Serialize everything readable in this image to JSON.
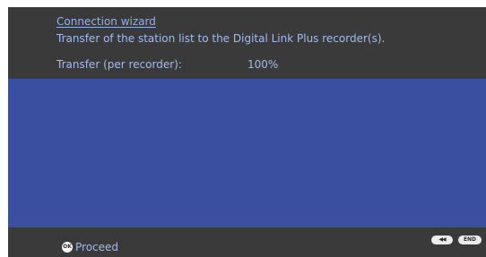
{
  "header": {
    "title": "Connection wizard",
    "subtitle": "Transfer of the station list to the Digital Link Plus recorder(s).",
    "transfer_label": "Transfer (per recorder):",
    "transfer_value": "100%"
  },
  "footer": {
    "proceed_label": "Proceed",
    "ok_icon_text": "OK",
    "rewind_icon_text": "◀◀",
    "end_label": "END"
  },
  "colors": {
    "frame": "#3a3a3a",
    "content": "#3a4f9f",
    "text": "#9fbdf0"
  },
  "icons": {
    "ok": "ok-button-icon",
    "rewind": "rewind-icon"
  }
}
